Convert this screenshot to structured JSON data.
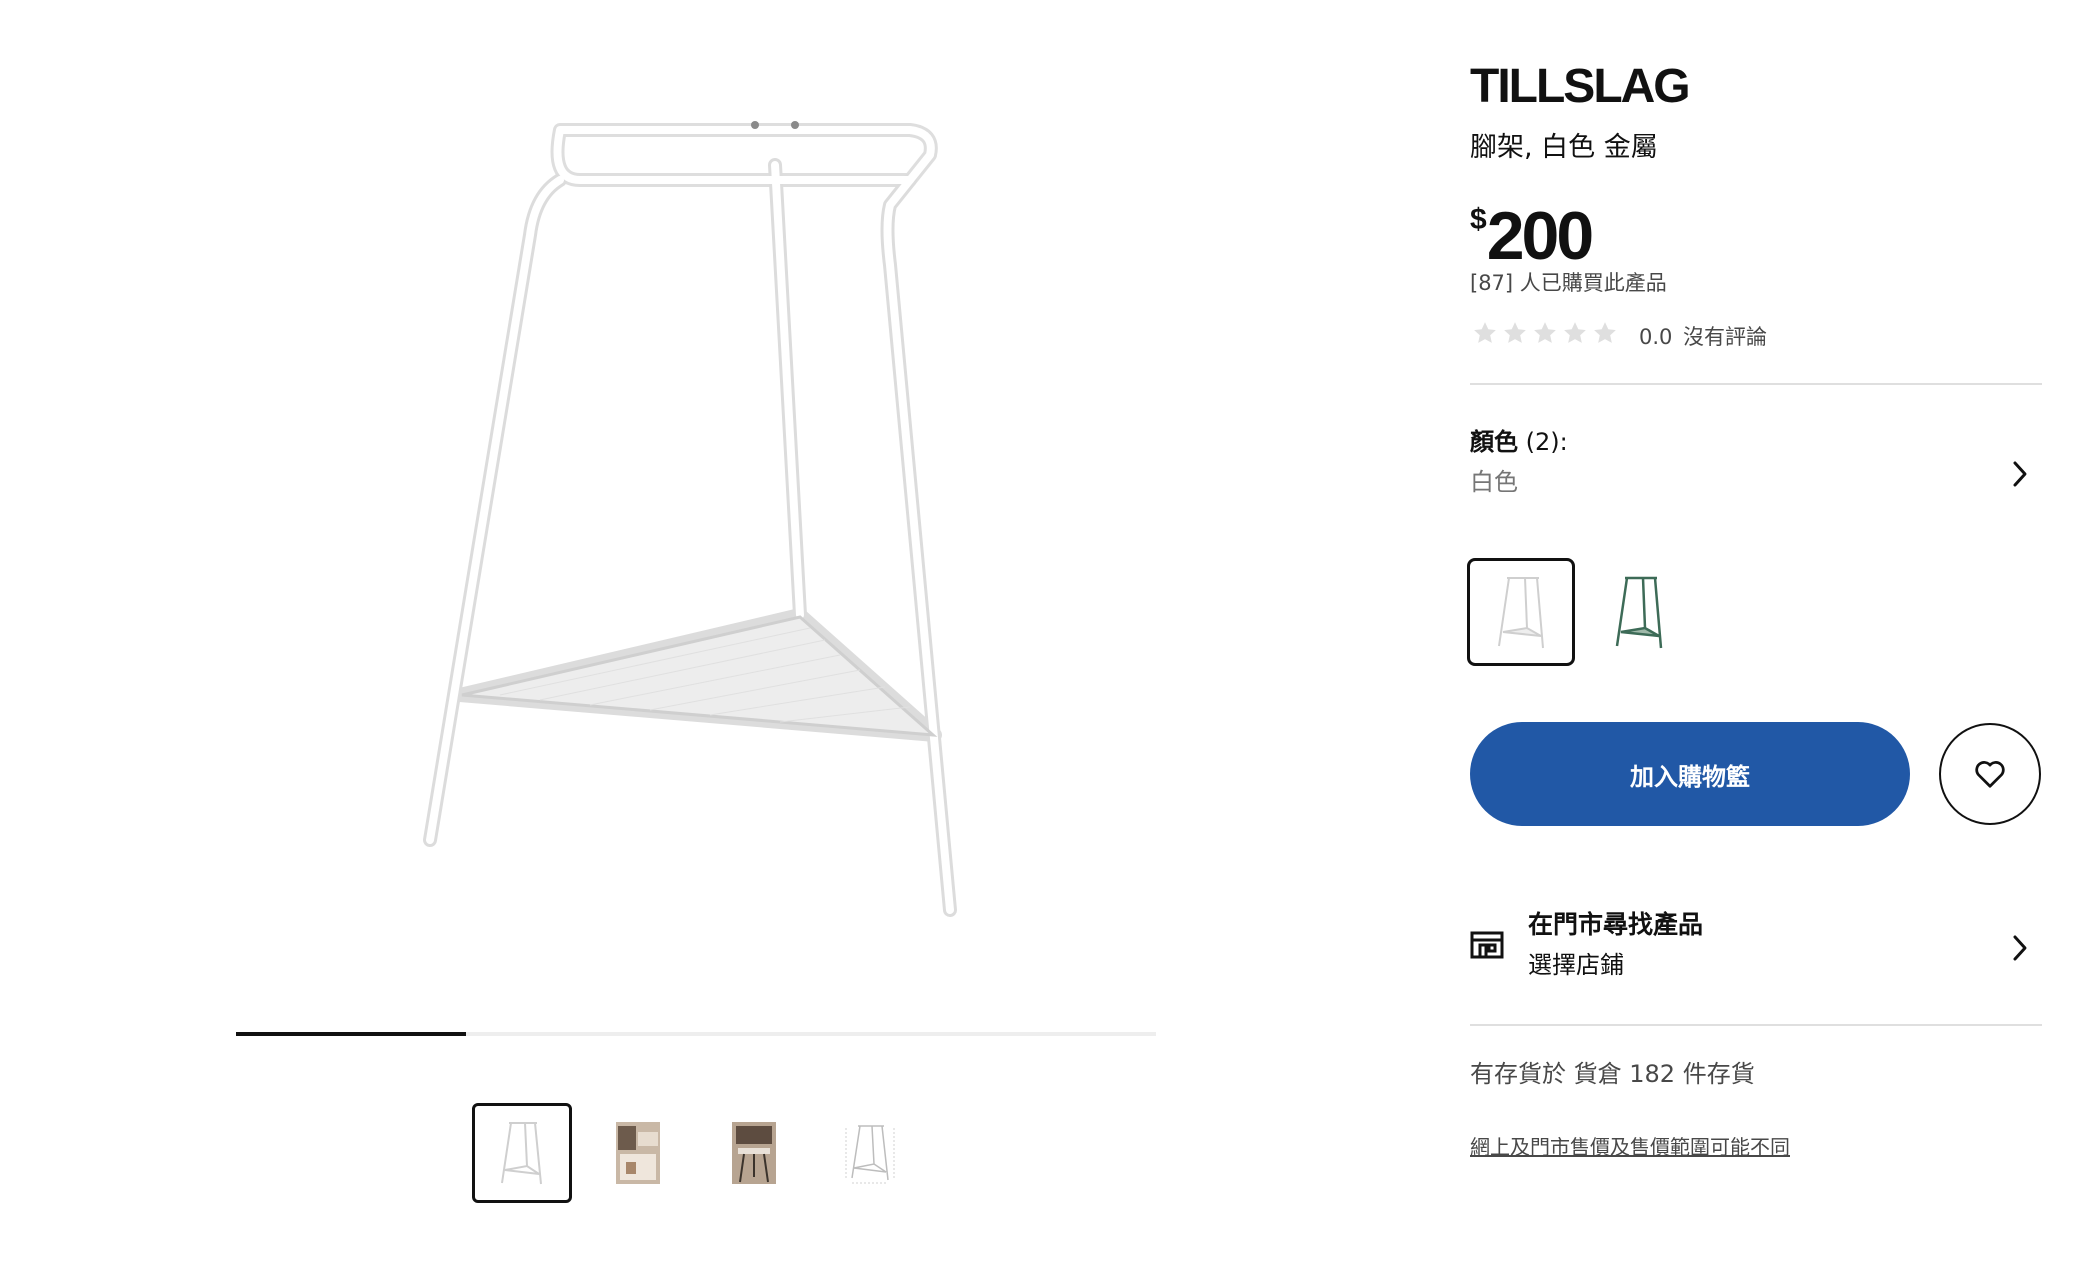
{
  "product": {
    "name": "TILLSLAG",
    "description": "腳架, 白色 金屬",
    "currency_symbol": "$",
    "price": "200",
    "purchased_text": "[87] 人已購買此產品",
    "rating": {
      "value": "0.0",
      "stars_total": 5,
      "stars_filled": 0,
      "reviews_text": "沒有評論"
    }
  },
  "gallery": {
    "progress_fraction": 0.25,
    "thumbnails": [
      {
        "name": "thumbnail-white-trestle",
        "active": true
      },
      {
        "name": "thumbnail-room-scene-1",
        "active": false
      },
      {
        "name": "thumbnail-room-scene-2",
        "active": false
      },
      {
        "name": "thumbnail-dimensions",
        "active": false
      }
    ]
  },
  "color": {
    "label": "顏色",
    "count_text": "(2):",
    "selected": "白色",
    "options": [
      {
        "name": "white",
        "color": "#e8e8e8",
        "active": true
      },
      {
        "name": "green",
        "color": "#3d6b57",
        "active": false
      }
    ]
  },
  "actions": {
    "add_to_cart": "加入購物籃",
    "wishlist_icon": "heart-icon"
  },
  "store": {
    "title": "在門市尋找產品",
    "subtitle": "選擇店鋪",
    "icon": "store-icon"
  },
  "stock_text": "有存貨於 貨倉 182 件存貨",
  "price_note": "網上及門市售價及售價範圍可能不同",
  "colors": {
    "accent": "#2158a6",
    "star_empty": "#dfdfdf"
  }
}
